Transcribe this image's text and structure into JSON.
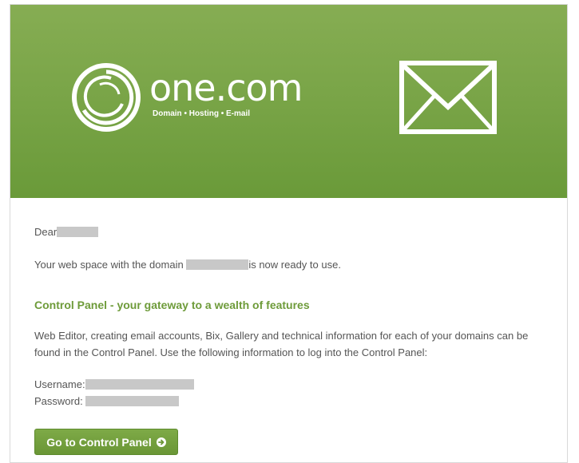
{
  "header": {
    "brand_name": "one.com",
    "tagline": "Domain • Hosting • E-mail",
    "icons": [
      "swirl-logo-icon",
      "envelope-icon"
    ]
  },
  "greeting": {
    "salutation": "Dear"
  },
  "ready_message": {
    "before": "Your web space with the domain",
    "after": "is now ready to use."
  },
  "control_panel": {
    "title": "Control Panel - your gateway to a wealth of features",
    "description": "Web Editor, creating email accounts, Bix, Gallery and technical information for each of your domains can be found in the Control Panel. Use the following information to log into the Control Panel:",
    "username_label": "Username:",
    "password_label": "Password:",
    "button_label": "Go to Control Panel"
  },
  "colors": {
    "header_green": "#7aa548",
    "accent_green": "#6e9b3a",
    "text_gray": "#555555",
    "redaction_gray": "#c8c8c8"
  }
}
